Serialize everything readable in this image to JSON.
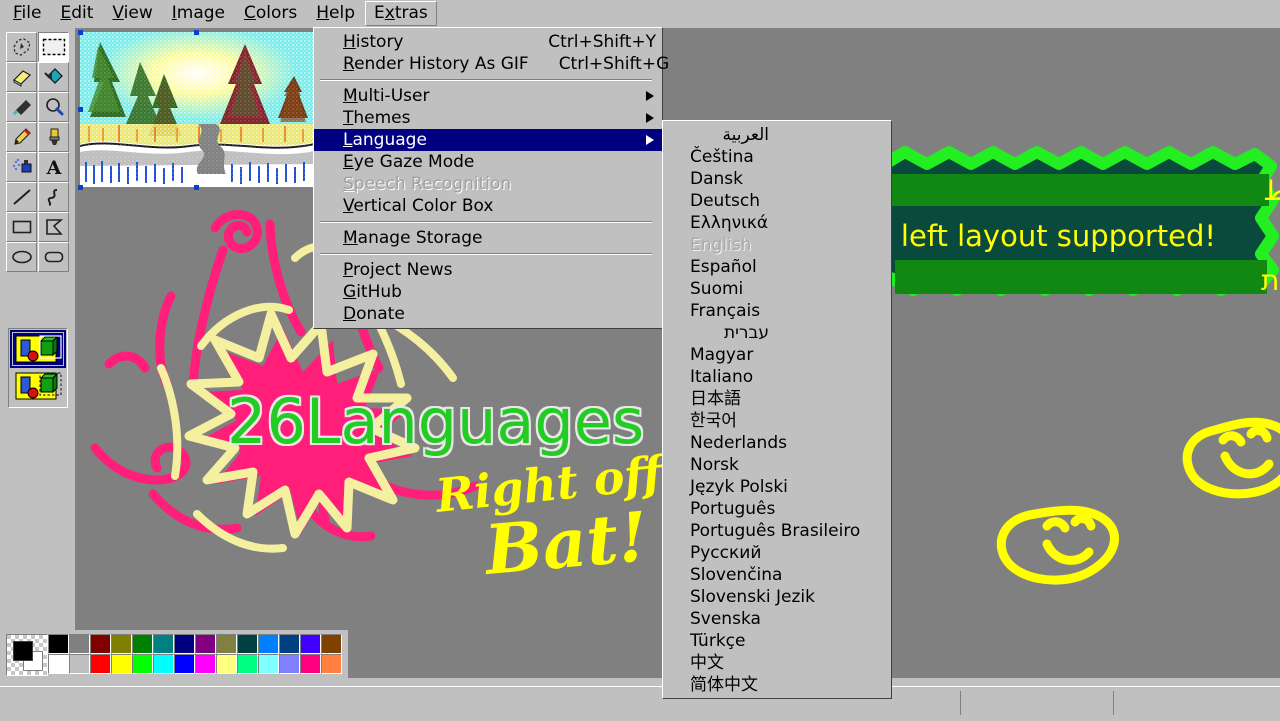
{
  "menubar": {
    "items": [
      {
        "label": "File",
        "accesskey": "F"
      },
      {
        "label": "Edit",
        "accesskey": "E"
      },
      {
        "label": "View",
        "accesskey": "V"
      },
      {
        "label": "Image",
        "accesskey": "I"
      },
      {
        "label": "Colors",
        "accesskey": "C"
      },
      {
        "label": "Help",
        "accesskey": "H"
      },
      {
        "label": "Extras",
        "accesskey": "x"
      }
    ]
  },
  "extras_menu": {
    "items": [
      {
        "label": "History",
        "accel": "Ctrl+Shift+Y",
        "state": "normal",
        "submenu": false
      },
      {
        "label": "Render History As GIF",
        "accel": "Ctrl+Shift+G",
        "state": "normal",
        "submenu": false
      },
      {
        "sep": true
      },
      {
        "label": "Multi-User",
        "accel": "",
        "state": "normal",
        "submenu": true
      },
      {
        "label": "Themes",
        "accel": "",
        "state": "normal",
        "submenu": true
      },
      {
        "label": "Language",
        "accel": "",
        "state": "highlighted",
        "submenu": true
      },
      {
        "label": "Eye Gaze Mode",
        "accel": "",
        "state": "normal",
        "submenu": false
      },
      {
        "label": "Speech Recognition",
        "accel": "",
        "state": "disabled",
        "submenu": false
      },
      {
        "label": "Vertical Color Box",
        "accel": "",
        "state": "normal",
        "submenu": false
      },
      {
        "sep": true
      },
      {
        "label": "Manage Storage",
        "accel": "",
        "state": "normal",
        "submenu": false
      },
      {
        "sep": true
      },
      {
        "label": "Project News",
        "accel": "",
        "state": "normal",
        "submenu": false
      },
      {
        "label": "GitHub",
        "accel": "",
        "state": "normal",
        "submenu": false
      },
      {
        "label": "Donate",
        "accel": "",
        "state": "normal",
        "submenu": false
      }
    ]
  },
  "language_menu": {
    "items": [
      {
        "label": "العربية",
        "state": "normal",
        "rtl": true
      },
      {
        "label": "Čeština",
        "state": "normal",
        "rtl": false
      },
      {
        "label": "Dansk",
        "state": "normal",
        "rtl": false
      },
      {
        "label": "Deutsch",
        "state": "normal",
        "rtl": false
      },
      {
        "label": "Ελληνικά",
        "state": "normal",
        "rtl": false
      },
      {
        "label": "English",
        "state": "disabled",
        "rtl": false
      },
      {
        "label": "Español",
        "state": "normal",
        "rtl": false
      },
      {
        "label": "Suomi",
        "state": "normal",
        "rtl": false
      },
      {
        "label": "Français",
        "state": "normal",
        "rtl": false
      },
      {
        "label": "עברית",
        "state": "normal",
        "rtl": true
      },
      {
        "label": "Magyar",
        "state": "normal",
        "rtl": false
      },
      {
        "label": "Italiano",
        "state": "normal",
        "rtl": false
      },
      {
        "label": "日本語",
        "state": "normal",
        "rtl": false
      },
      {
        "label": "한국어",
        "state": "normal",
        "rtl": false
      },
      {
        "label": "Nederlands",
        "state": "normal",
        "rtl": false
      },
      {
        "label": "Norsk",
        "state": "normal",
        "rtl": false
      },
      {
        "label": "Język Polski",
        "state": "normal",
        "rtl": false
      },
      {
        "label": "Português",
        "state": "normal",
        "rtl": false
      },
      {
        "label": "Português Brasileiro",
        "state": "normal",
        "rtl": false
      },
      {
        "label": "Русский",
        "state": "normal",
        "rtl": false
      },
      {
        "label": "Slovenčina",
        "state": "normal",
        "rtl": false
      },
      {
        "label": "Slovenski Jezik",
        "state": "normal",
        "rtl": false
      },
      {
        "label": "Svenska",
        "state": "normal",
        "rtl": false
      },
      {
        "label": "Türkçe",
        "state": "normal",
        "rtl": false
      },
      {
        "label": "中文",
        "state": "normal",
        "rtl": false
      },
      {
        "label": "简体中文",
        "state": "normal",
        "rtl": false
      }
    ]
  },
  "toolbox": {
    "tools": [
      {
        "name": "free-form-select",
        "active": false
      },
      {
        "name": "rectangle-select",
        "active": true
      },
      {
        "name": "eraser",
        "active": false
      },
      {
        "name": "fill",
        "active": false
      },
      {
        "name": "color-picker",
        "active": false
      },
      {
        "name": "magnifier",
        "active": false
      },
      {
        "name": "pencil",
        "active": false
      },
      {
        "name": "brush",
        "active": false
      },
      {
        "name": "airbrush",
        "active": false
      },
      {
        "name": "text",
        "active": false
      },
      {
        "name": "line",
        "active": false
      },
      {
        "name": "curve",
        "active": false
      },
      {
        "name": "rectangle",
        "active": false
      },
      {
        "name": "polygon",
        "active": false
      },
      {
        "name": "ellipse",
        "active": false
      },
      {
        "name": "rounded-rectangle",
        "active": false
      }
    ],
    "options": [
      {
        "name": "opaque-selection",
        "selected": true
      },
      {
        "name": "transparent-selection",
        "selected": false
      }
    ]
  },
  "palette": {
    "foreground": "#000000",
    "background": "#ffffff",
    "row_top": [
      "#000000",
      "#808080",
      "#800000",
      "#808000",
      "#008000",
      "#008080",
      "#000080",
      "#800080",
      "#808040",
      "#004040",
      "#0080ff",
      "#004080",
      "#4000ff",
      "#804000"
    ],
    "row_bottom": [
      "#ffffff",
      "#c0c0c0",
      "#ff0000",
      "#ffff00",
      "#00ff00",
      "#00ffff",
      "#0000ff",
      "#ff00ff",
      "#ffff80",
      "#00ff80",
      "#80ffff",
      "#8080ff",
      "#ff0080",
      "#ff8040"
    ]
  },
  "artwork": {
    "headline_number": "26",
    "headline_word": "Languages",
    "headline_color": "#22cc22",
    "hand_line_1": "Right off the",
    "hand_line_2": "Bat!",
    "hand_color": "#ffff00",
    "starburst_color": "#ff1f7a",
    "squiggle_color": "#f5f0a0",
    "smileys": [
      {
        "name": "smiley-face-lower",
        "color": "#ffff00"
      },
      {
        "name": "smiley-face-upper",
        "color": "#ffff00"
      }
    ],
    "thumbnail_caption": "pointillist winter forest painting"
  },
  "speech_bubble": {
    "fill_color": "#0a4a3c",
    "border_color": "#22ee22",
    "highlight_color": "#118811",
    "text_color": "#ffff00",
    "lines": [
      {
        "text": "دعم من اليمين إلى اليسار التخطيط",
        "dir": "rtl",
        "highlighted": true
      },
      {
        "text": "Right to left layout supported!",
        "dir": "ltr",
        "highlighted": false
      },
      {
        "text": "פריסה מימין לשמאל נתמכת",
        "dir": "rtl",
        "highlighted": true
      }
    ]
  },
  "statusbar": {
    "message": "",
    "cell_2": "",
    "cell_3": ""
  }
}
